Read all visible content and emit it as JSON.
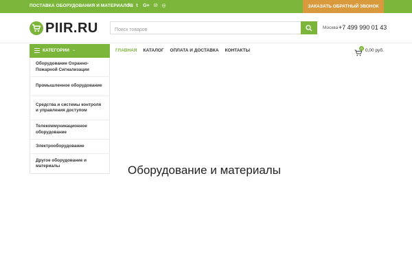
{
  "topbar": {
    "slogan": "ПОСТАВКА ОБОРУДОВАНИЯ И МАТЕРИАЛОВ",
    "social": [
      {
        "name": "facebook-icon",
        "glyph": "f"
      },
      {
        "name": "twitter-icon",
        "glyph": "t"
      },
      {
        "name": "google-plus-icon",
        "glyph": "G+"
      },
      {
        "name": "mail-icon",
        "glyph": "✉"
      },
      {
        "name": "odnoklassniki-icon",
        "glyph": "◎"
      }
    ],
    "callback_label": "ЗАКАЗАТЬ ОБРАТНЫЙ ЗВОНОК"
  },
  "header": {
    "logo_text": "PIIR.RU",
    "search_placeholder": "Поиск товаров",
    "phone_label": "Москва",
    "phone": "+7 499 990 01 43"
  },
  "categories": {
    "label": "КАТЕГОРИИ",
    "items": [
      "Оборудование Охранно-Пожарной Сигнализации",
      "Промышленное оборудование",
      "Средства и системы контроля и управления доступом",
      "Телекоммуникационное оборудование",
      "Электрооборудование",
      "Другое оборудование и материалы"
    ]
  },
  "nav": {
    "items": [
      "ГЛАВНАЯ",
      "КАТАЛОГ",
      "ОПЛАТА И ДОСТАВКА",
      "КОНТАКТЫ"
    ]
  },
  "cart": {
    "count": "0",
    "total": "0,00 руб."
  },
  "main": {
    "title": "Оборудование и материалы"
  },
  "colors": {
    "accent": "#7bb63a",
    "callback": "#d99a3e"
  }
}
